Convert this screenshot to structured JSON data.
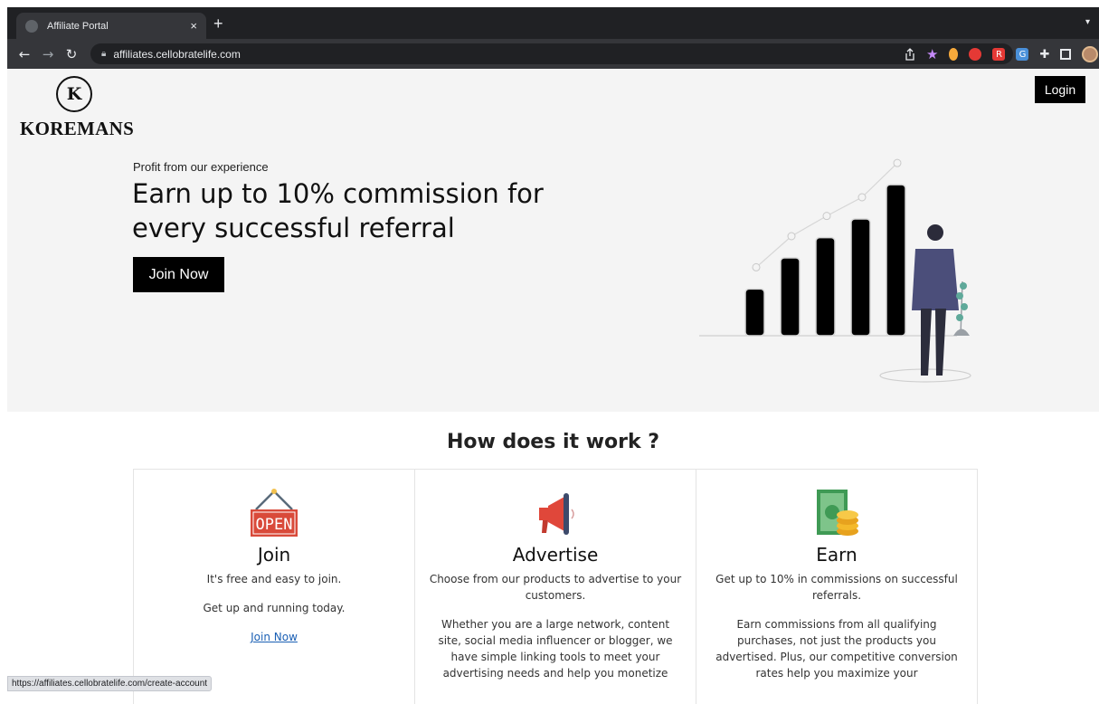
{
  "browser": {
    "tab_title": "Affiliate Portal",
    "tab_close": "×",
    "new_tab": "+",
    "url": "affiliates.cellobratelife.com",
    "status_url": "https://affiliates.cellobratelife.com/create-account"
  },
  "header": {
    "logo_monogram": "K",
    "logo_text": "KOREMANS",
    "login_label": "Login"
  },
  "hero": {
    "subtitle": "Profit from our experience",
    "title": "Earn up to 10% commission for every successful referral",
    "cta_label": "Join Now",
    "bar_levels": [
      0.3,
      0.5,
      0.63,
      0.75,
      0.97
    ]
  },
  "how": {
    "title": "How does it work ?",
    "cards": [
      {
        "icon": "open-sign-icon",
        "sign_text": "OPEN",
        "title": "Join",
        "p1": "It's free and easy to join.",
        "p2": "Get up and running today.",
        "link": "Join Now"
      },
      {
        "icon": "megaphone-icon",
        "title": "Advertise",
        "p1": "Choose from our products to advertise to your customers.",
        "p2": "Whether you are a large network, content site, social media influencer or blogger, we have simple linking tools to meet your advertising needs and help you monetize"
      },
      {
        "icon": "money-coins-icon",
        "title": "Earn",
        "p1": "Get up to 10% in commissions on successful referrals.",
        "p2": "Earn commissions from all qualifying purchases, not just the products you advertised. Plus, our competitive conversion rates help you maximize your"
      }
    ]
  }
}
